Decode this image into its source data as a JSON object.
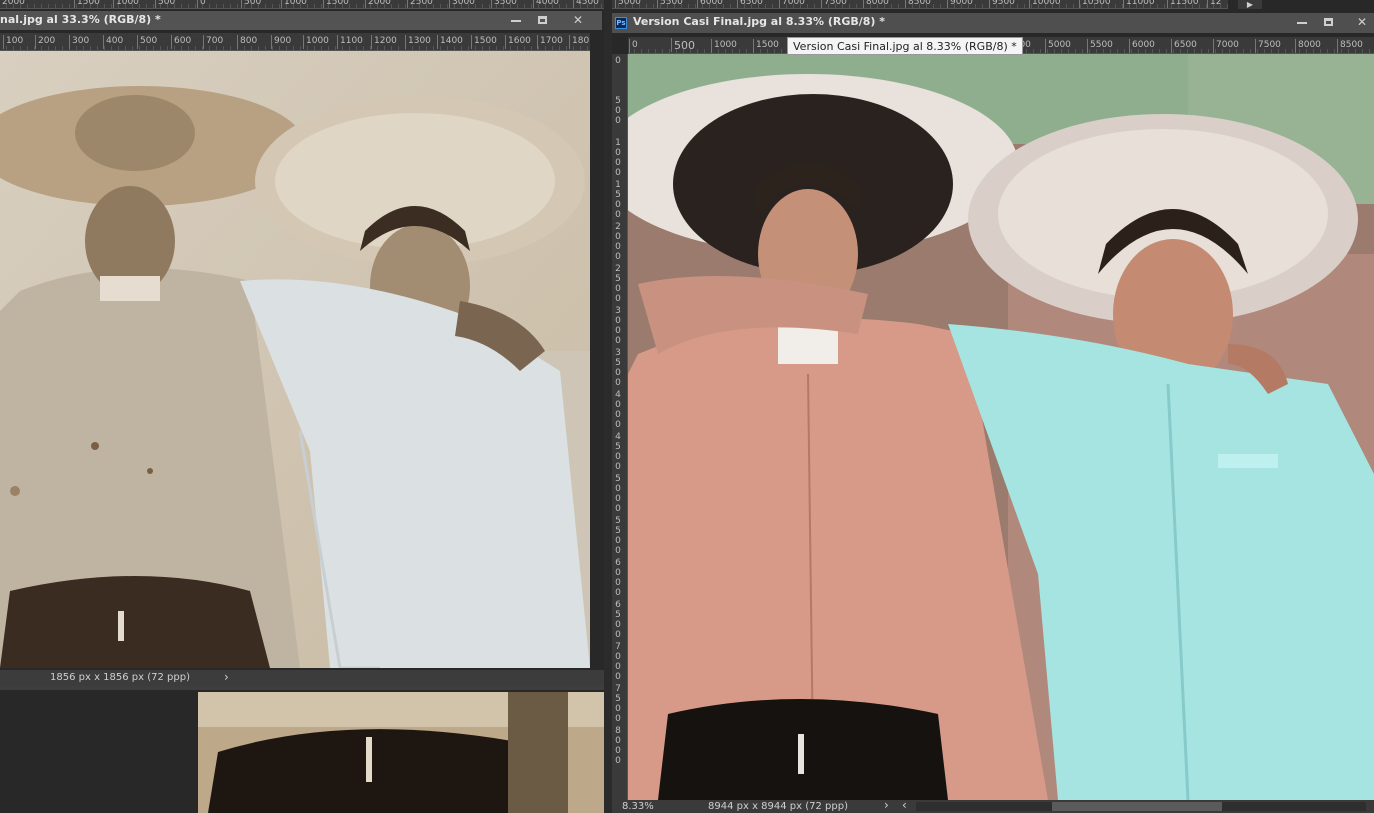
{
  "top_ruler_left": {
    "ticks": [
      "2000",
      "1500",
      "1000",
      "500",
      "0",
      "500",
      "1000",
      "1500",
      "2000",
      "2500",
      "3000",
      "3500",
      "4000",
      "4500"
    ]
  },
  "top_ruler_right": {
    "ticks": [
      "5000",
      "5500",
      "6000",
      "6500",
      "7000",
      "7500",
      "8000",
      "8500",
      "9000",
      "9500",
      "10000",
      "10500",
      "11000",
      "11500",
      "12"
    ]
  },
  "left_doc": {
    "title": "nal.jpg al 33.3% (RGB/8) *",
    "ruler_ticks": [
      "100",
      "200",
      "300",
      "400",
      "500",
      "600",
      "700",
      "800",
      "900",
      "1000",
      "1100",
      "1200",
      "1300",
      "1400",
      "1500",
      "1600",
      "1700",
      "180"
    ],
    "status_dimensions": "1856 px x 1856 px (72 ppp)",
    "status_arrow": "›"
  },
  "right_doc": {
    "title": "Version Casi Final.jpg al 8.33% (RGB/8) *",
    "tooltip": "Version Casi Final.jpg al 8.33% (RGB/8) *",
    "app_badge": "Ps",
    "ruler_ticks_left": [
      "0",
      "500",
      "1000",
      "1500"
    ],
    "ruler_ticks_right": [
      "4500",
      "5000",
      "5500",
      "6000",
      "6500",
      "7000",
      "7500",
      "8000",
      "8500"
    ],
    "vertical_ticks": [
      "0",
      "500",
      "1000",
      "1500",
      "2000",
      "2500",
      "3000",
      "3500",
      "4000",
      "4500",
      "5000",
      "5500",
      "6000",
      "6500",
      "7000",
      "7500",
      "8000"
    ],
    "status_zoom": "8.33%",
    "status_dimensions": "8944 px x 8944 px (72 ppp)",
    "status_arrow": "›",
    "scroll_left_arrow": "‹"
  },
  "icons": {
    "minimize": "minimize-icon",
    "maximize": "maximize-icon",
    "close": "close-icon",
    "close_glyph": "✕"
  }
}
